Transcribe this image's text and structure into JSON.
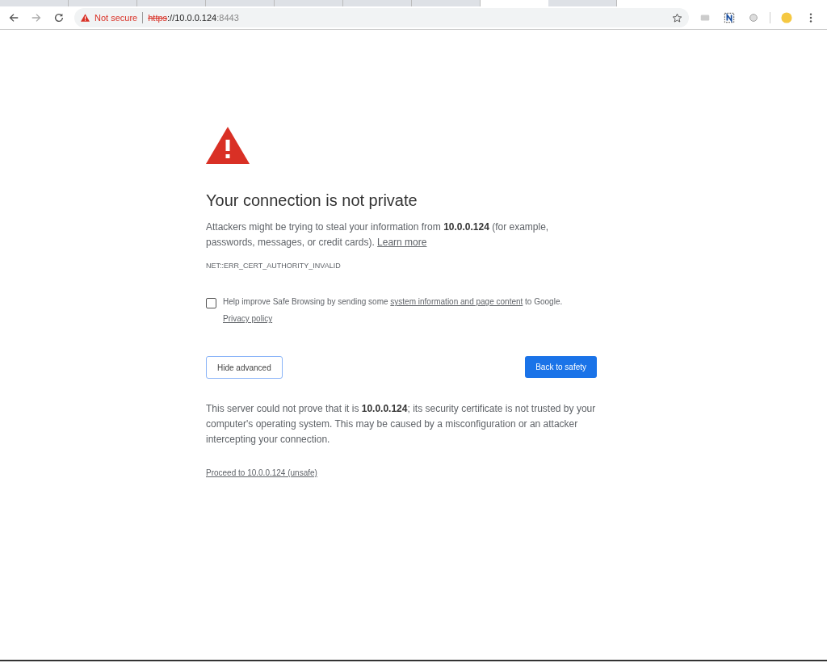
{
  "toolbar": {
    "security_label": "Not secure",
    "url": {
      "scheme": "https",
      "host": "://10.0.0.124",
      "port": ":8443"
    }
  },
  "page": {
    "title": "Your connection is not private",
    "intro": {
      "before": "Attackers might be trying to steal your information from **10.0.0.124** (for example, passwords, messages, or credit cards).",
      "link": "Learn more"
    },
    "error_code": "NET::ERR_CERT_AUTHORITY_INVALID",
    "opt_in": {
      "checked": false,
      "before": "Help improve Safe Browsing by sending some",
      "link": "system information and page content",
      "after": "to Google.",
      "policy_link": "Privacy policy"
    },
    "buttons": {
      "secondary": "Hide advanced",
      "primary": "Back to safety"
    },
    "details": "This server could not prove that it is **10.0.0.124**; its security certificate is not trusted by your computer's operating system. This may be caused by a misconfiguration or an attacker intercepting your connection.",
    "proceed_link": "Proceed to 10.0.0.124 (unsafe)"
  }
}
